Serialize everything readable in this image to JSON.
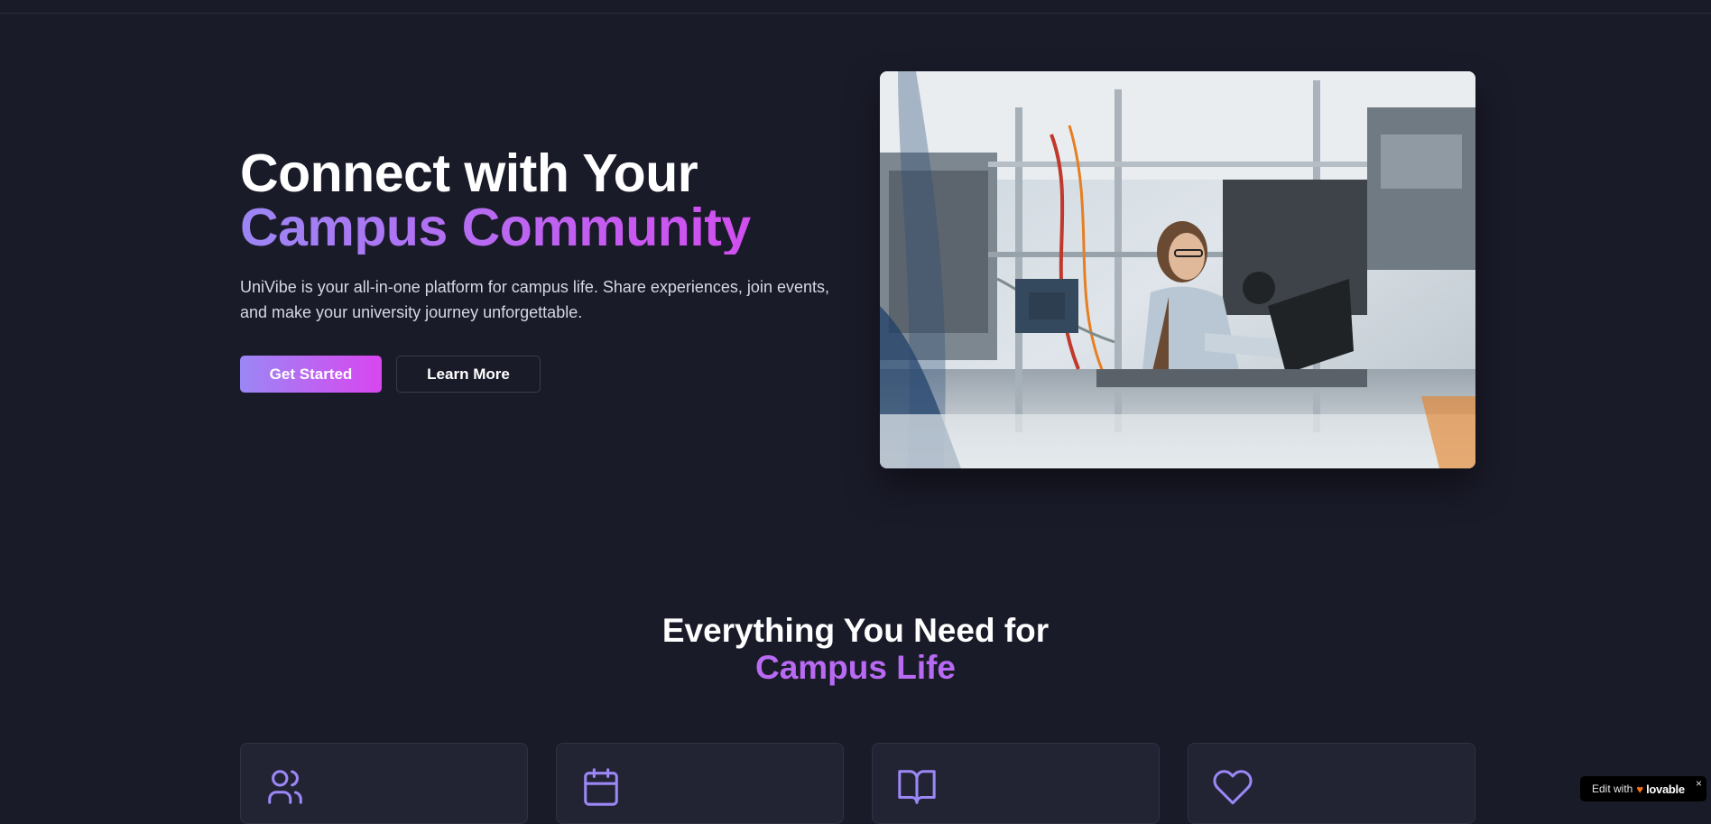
{
  "hero": {
    "title_line1": "Connect with Your",
    "title_line2": "Campus Community",
    "description": "UniVibe is your all-in-one platform for campus life. Share experiences, join events, and make your university journey unforgettable.",
    "primary_button": "Get Started",
    "secondary_button": "Learn More"
  },
  "features": {
    "title_line1": "Everything You Need for",
    "title_line2": "Campus Life",
    "cards": [
      {
        "icon": "users-icon"
      },
      {
        "icon": "calendar-icon"
      },
      {
        "icon": "book-open-icon"
      },
      {
        "icon": "heart-icon"
      }
    ]
  },
  "badge": {
    "prefix": "Edit with",
    "brand": "lovable",
    "close": "×"
  },
  "colors": {
    "background": "#1a1b29",
    "accent_start": "#9b87f5",
    "accent_end": "#d946ef",
    "card_bg": "#222333"
  }
}
